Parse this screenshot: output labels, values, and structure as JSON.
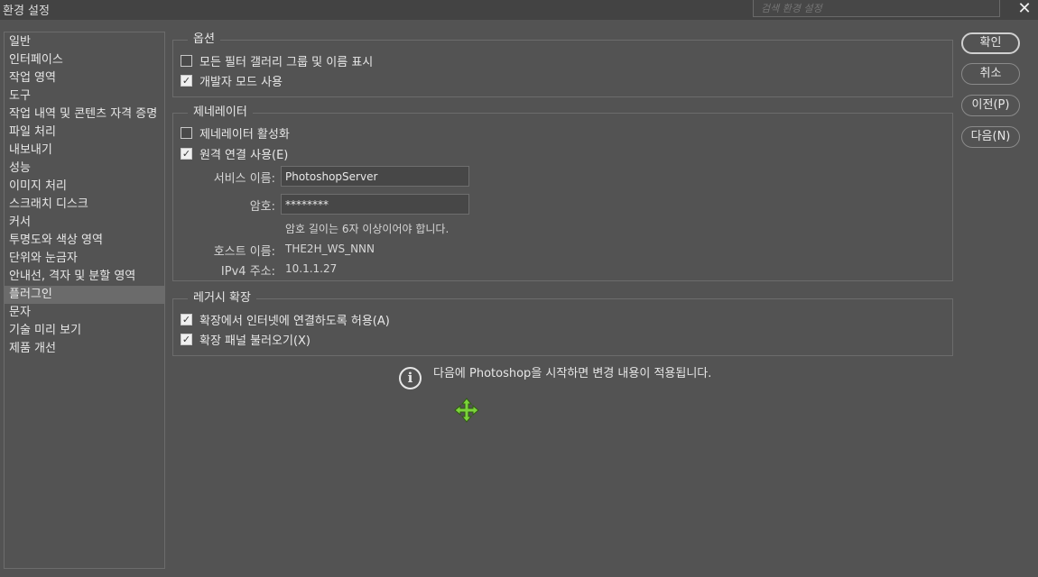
{
  "window": {
    "title": "환경 설정",
    "search_placeholder": "검색 환경 설정",
    "close_glyph": "✕"
  },
  "sidebar": {
    "items": [
      {
        "label": "일반"
      },
      {
        "label": "인터페이스"
      },
      {
        "label": "작업 영역"
      },
      {
        "label": "도구"
      },
      {
        "label": "작업 내역 및 콘텐츠 자격 증명"
      },
      {
        "label": "파일 처리"
      },
      {
        "label": "내보내기"
      },
      {
        "label": "성능"
      },
      {
        "label": "이미지 처리"
      },
      {
        "label": "스크래치 디스크"
      },
      {
        "label": "커서"
      },
      {
        "label": "투명도와 색상 영역"
      },
      {
        "label": "단위와 눈금자"
      },
      {
        "label": "안내선, 격자 및 분할 영역"
      },
      {
        "label": "플러그인",
        "selected": true
      },
      {
        "label": "문자"
      },
      {
        "label": "기술 미리 보기"
      },
      {
        "label": "제품 개선"
      }
    ]
  },
  "options": {
    "legend": "옵션",
    "show_filter_gallery": {
      "label": "모든 필터 갤러리 그룹 및 이름 표시",
      "checked": false
    },
    "developer_mode": {
      "label": "개발자 모드 사용",
      "checked": true
    }
  },
  "generator": {
    "legend": "제네레이터",
    "enable": {
      "label": "제네레이터 활성화",
      "checked": false
    },
    "remote": {
      "label": "원격 연결 사용(E)",
      "checked": true
    },
    "service_name_label": "서비스 이름:",
    "service_name_value": "PhotoshopServer",
    "password_label": "암호:",
    "password_value": "********",
    "password_hint": "암호 길이는 6자 이상이어야 합니다.",
    "host_label": "호스트 이름:",
    "host_value": "THE2H_WS_NNN",
    "ipv4_label": "IPv4 주소:",
    "ipv4_value": "10.1.1.27"
  },
  "legacy": {
    "legend": "레거시 확장",
    "allow_internet": {
      "label": "확장에서 인터넷에 연결하도록 허용(A)",
      "checked": true
    },
    "load_panels": {
      "label": "확장 패널 불러오기(X)",
      "checked": true
    }
  },
  "notice": {
    "icon": "info-icon",
    "text": "다음에 Photoshop을 시작하면 변경 내용이 적용됩니다."
  },
  "buttons": {
    "ok": "확인",
    "cancel": "취소",
    "prev": "이전(P)",
    "next": "다음(N)"
  },
  "colors": {
    "background": "#535353",
    "titlebar": "#434343",
    "selected_item": "#6b6b6b",
    "cursor_green": "#7bd33a"
  }
}
